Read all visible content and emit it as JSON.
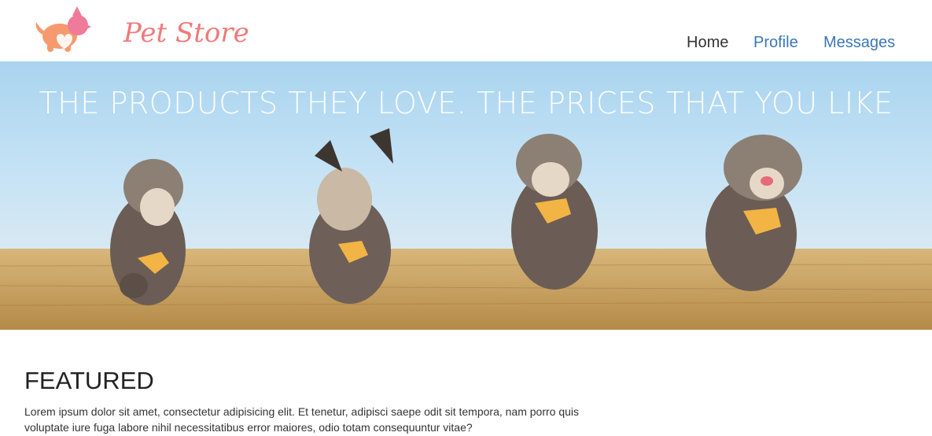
{
  "brand": {
    "name": "Pet Store",
    "logo_icon": "dog-icon",
    "color": "#f07a7a"
  },
  "nav": {
    "home": "Home",
    "profile": "Profile",
    "messages": "Messages"
  },
  "hero": {
    "title": "THE PRODUCTS THEY LOVE. THE PRICES THAT YOU LIKE",
    "dogs": 4
  },
  "featured": {
    "heading": "FEATURED",
    "text": "Lorem ipsum dolor sit amet, consectetur adipisicing elit. Et tenetur, adipisci saepe odit sit tempora, nam porro quis voluptate iure fuga labore nihil necessitatibus error maiores, odio totam consequuntur vitae?"
  }
}
